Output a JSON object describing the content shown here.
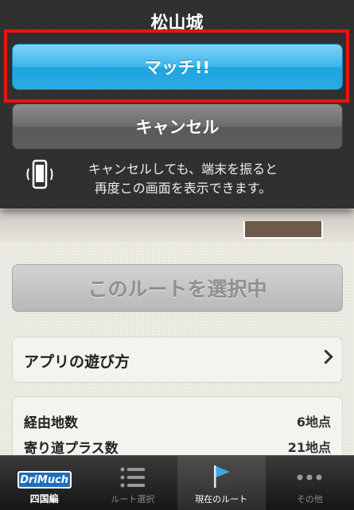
{
  "dialog": {
    "title": "松山城",
    "match_label": "マッチ!!",
    "cancel_label": "キャンセル",
    "notice_line1": "キャンセルしても、端末を振ると",
    "notice_line2": "再度この画面を表示できます。"
  },
  "main": {
    "selected_route_label": "このルートを選択中",
    "howto_label": "アプリの遊び方",
    "stats": [
      {
        "label": "経由地数",
        "value": "6地点"
      },
      {
        "label": "寄り道プラス数",
        "value": "21地点"
      }
    ]
  },
  "tabbar": {
    "brand_logo": "DriMuch",
    "tabs": [
      {
        "label": "四国編",
        "icon": "drimuch-logo-icon"
      },
      {
        "label": "ルート選択",
        "icon": "list-icon"
      },
      {
        "label": "現在のルート",
        "icon": "flag-icon"
      },
      {
        "label": "その他",
        "icon": "more-dots-icon"
      }
    ]
  },
  "colors": {
    "match_blue": "#2aaae4",
    "highlight_red": "#e8140f",
    "cancel_gray": "#6c6c6c"
  }
}
